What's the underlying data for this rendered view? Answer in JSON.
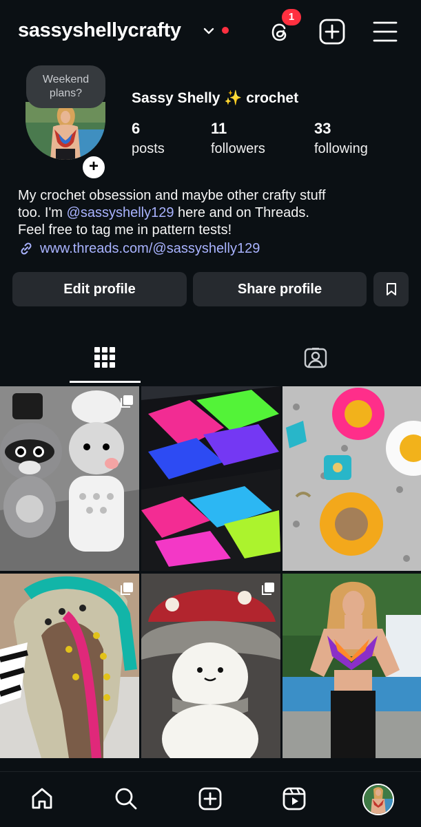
{
  "header": {
    "username": "sassyshellycrafty",
    "notification_count": "1",
    "icons": [
      "chevron-down-icon",
      "threads-icon",
      "add-post-icon",
      "menu-icon"
    ]
  },
  "profile": {
    "note": "Weekend plans?",
    "avatar_add": "+",
    "display_name": "Sassy Shelly ✨ crochet",
    "stats": {
      "posts_count": "6",
      "posts_label": "posts",
      "followers_count": "11",
      "followers_label": "followers",
      "following_count": "33",
      "following_label": "following"
    },
    "bio": {
      "line1": "My crochet obsession and maybe other crafty stuff",
      "line2_pre": "too. I'm ",
      "line2_mention": "@sassyshelly129",
      "line2_post": " here and on Threads.",
      "line3": "Feel free to tag me in pattern tests!"
    },
    "link": "www.threads.com/@sassyshelly129"
  },
  "actions": {
    "edit_label": "Edit profile",
    "share_label": "Share profile"
  },
  "tabs": [
    {
      "name": "posts-grid",
      "icon": "grid-icon",
      "active": true
    },
    {
      "name": "tagged",
      "icon": "tagged-person-icon",
      "active": false
    }
  ],
  "posts": [
    {
      "subject": "crochet raccoon and opossum chef dolls",
      "multiple": true
    },
    {
      "subject": "neon crochet argyle scarf",
      "multiple": false
    },
    {
      "subject": "crochet flower keychains",
      "multiple": false
    },
    {
      "subject": "crochet monster hood",
      "multiple": true
    },
    {
      "subject": "crochet mushroom doll",
      "multiple": true
    },
    {
      "subject": "woman in rainbow crochet top",
      "multiple": false
    }
  ],
  "colors": {
    "background": "#0b1014",
    "button": "#262a2f",
    "link": "#a9b3ff",
    "badge": "#ff3040"
  },
  "bottom_nav": [
    "home-icon",
    "search-icon",
    "create-icon",
    "reels-icon",
    "profile-avatar"
  ]
}
